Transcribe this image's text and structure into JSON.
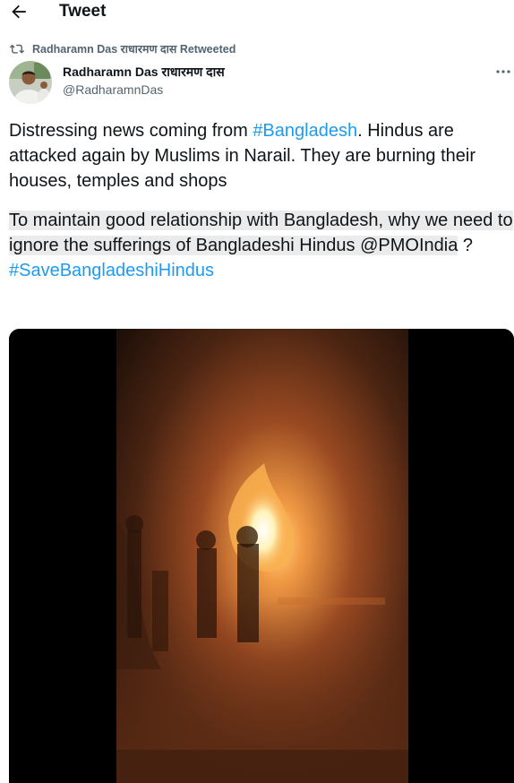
{
  "header": {
    "title": "Tweet"
  },
  "retweet": {
    "text": "Radharamn Das राधारमण दास Retweeted"
  },
  "author": {
    "name": "Radharamn Das राधारमण दास",
    "handle": "@RadharamnDas"
  },
  "tweet": {
    "p1_before": "Distressing news coming from ",
    "hashtag1": "#Bangladesh",
    "p1_after": ". Hindus are attacked again by Muslims in Narail. They are burning their houses, temples and shops",
    "p2_text": "To maintain good relationship with Bangladesh, why we need to ignore the sufferings of Bangladeshi Hindus ",
    "mention": "@PMOIndia",
    "p2_after": " ?",
    "hashtag2": "#SaveBangladeshiHindus"
  },
  "icons": [
    "back-arrow-icon",
    "retweet-icon",
    "more-icon"
  ],
  "colors": {
    "link": "#1d9bf0",
    "secondary_text": "#536471",
    "primary_text": "#0f1419",
    "highlight": "#ebebeb"
  }
}
